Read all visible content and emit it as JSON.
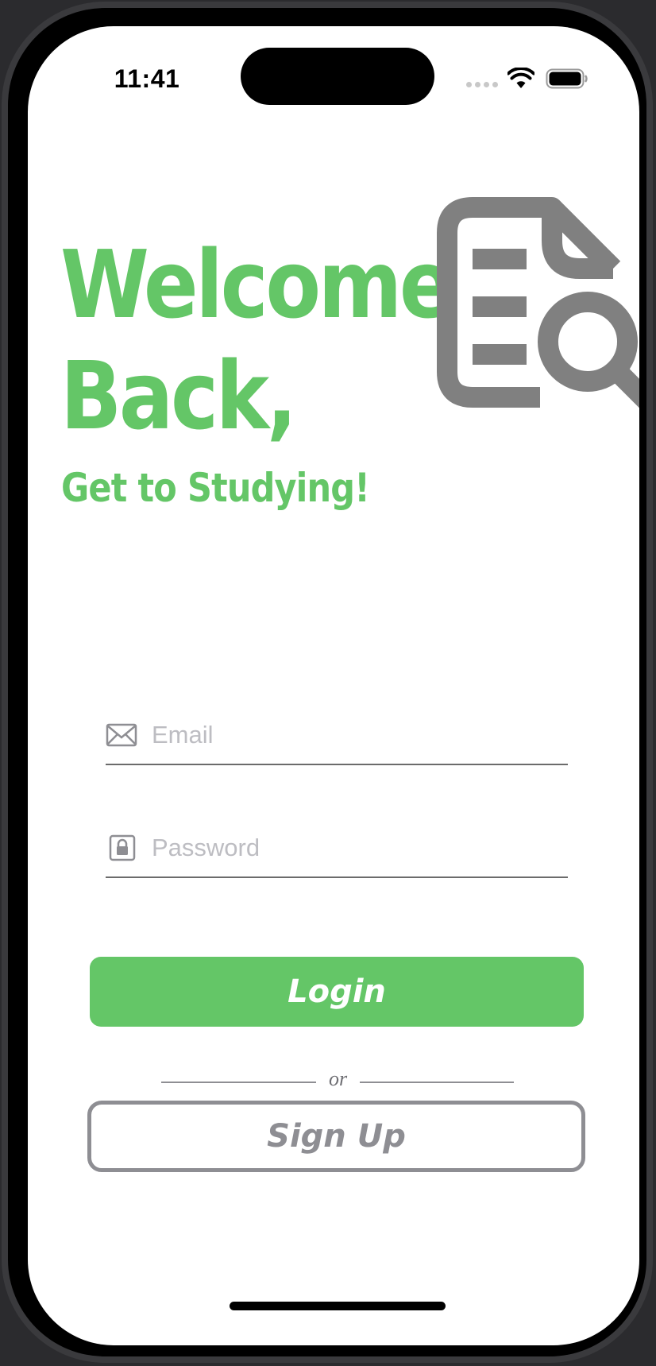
{
  "status_bar": {
    "time": "11:41"
  },
  "header": {
    "title_line1": "Welcome",
    "title_line2": "Back,",
    "subtitle": "Get to Studying!"
  },
  "form": {
    "email_placeholder": "Email",
    "email_value": "",
    "password_placeholder": "Password",
    "password_value": ""
  },
  "actions": {
    "login_label": "Login",
    "divider_text": "or",
    "signup_label": "Sign Up"
  },
  "icons": {
    "hero": "document-search-icon",
    "email": "envelope-icon",
    "password": "lock-icon",
    "wifi": "wifi-icon",
    "battery": "battery-icon"
  },
  "colors": {
    "accent": "#64c667",
    "secondary": "#8e8e93",
    "icon_gray": "#808080"
  }
}
